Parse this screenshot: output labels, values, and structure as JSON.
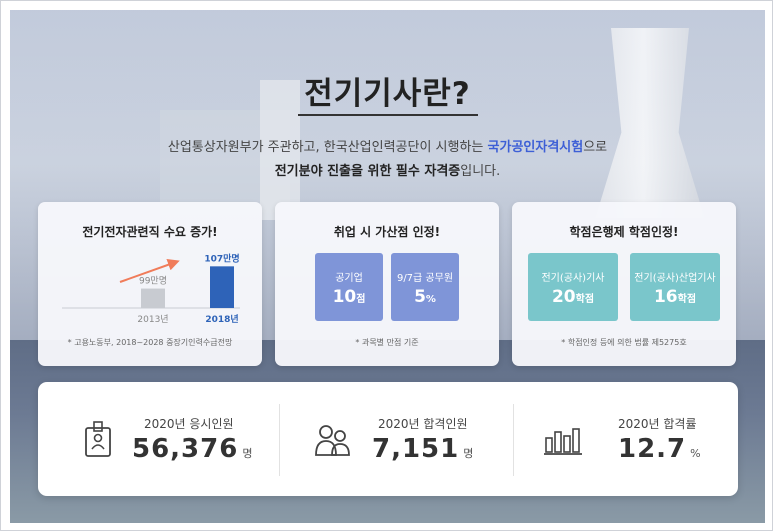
{
  "header": {
    "title": "전기기사란?",
    "sub1_pre": "산업통상자원부가 주관하고, 한국산업인력공단이 시행하는 ",
    "sub1_accent": "국가공인자격시험",
    "sub1_post": "으로",
    "sub2_bold": "전기분야 진출을 위한 필수 자격증",
    "sub2_post": "입니다."
  },
  "cards": [
    {
      "title": "전기전자관련직 수요 증가!",
      "chart_data": {
        "type": "bar",
        "categories": [
          "2013년",
          "2018년"
        ],
        "values": [
          99,
          107
        ],
        "value_labels": [
          "99만명",
          "107만명"
        ],
        "colors": [
          "#c8cbd1",
          "#2e63b8"
        ]
      },
      "note": "* 고용노동부, 2018~2028 중장기인력수급전망"
    },
    {
      "title": "취업 시 가산점 인정!",
      "boxes": [
        {
          "label": "공기업",
          "value": "10",
          "unit": "점"
        },
        {
          "label": "9/7급 공무원",
          "value": "5",
          "unit": "%"
        }
      ],
      "note": "* 과목별 만점 기준"
    },
    {
      "title": "학점은행제 학점인정!",
      "boxes": [
        {
          "label": "전기(공사)기사",
          "value": "20",
          "unit": "학점"
        },
        {
          "label": "전기(공사)산업기사",
          "value": "16",
          "unit": "학점"
        }
      ],
      "note": "* 학점인정 등에 의한 법률 제5275호"
    }
  ],
  "stats": [
    {
      "icon": "id-card-icon",
      "caption": "2020년 응시인원",
      "value": "56,376",
      "unit": "명"
    },
    {
      "icon": "people-icon",
      "caption": "2020년 합격인원",
      "value": "7,151",
      "unit": "명"
    },
    {
      "icon": "bar-chart-icon",
      "caption": "2020년 합격률",
      "value": "12.7",
      "unit": "%"
    }
  ]
}
